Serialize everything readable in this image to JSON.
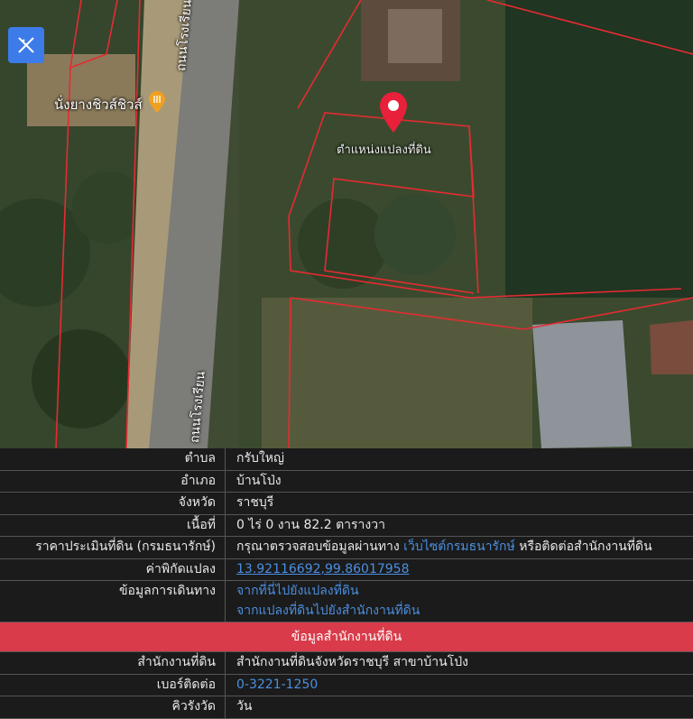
{
  "map": {
    "road_label_top": "ถนนโรงเรียน บ้านปูง",
    "road_label_bottom": "ถนนโรงเรียน",
    "poi_label": "นั่งยางชิวส์ชิวส์",
    "parcel_label": "ตำแหน่งแปลงที่ดิน",
    "tool_icon": "ruler-pencil-icon",
    "pin_color": "#e8203a"
  },
  "details": [
    {
      "label": "ตำบล",
      "value": "กรับใหญ่"
    },
    {
      "label": "อำเภอ",
      "value": "บ้านโป่ง"
    },
    {
      "label": "จังหวัด",
      "value": "ราชบุรี"
    },
    {
      "label": "เนื้อที่",
      "value": "0 ไร่ 0 งาน 82.2 ตารางวา"
    }
  ],
  "appraisal": {
    "label": "ราคาประเมินที่ดิน (กรมธนารักษ์)",
    "text_before": "กรุณาตรวจสอบข้อมูลผ่านทาง",
    "link": "เว็บไซต์กรมธนารักษ์",
    "text_after": "หรือติดต่อสำนักงานที่ดิน"
  },
  "coords": {
    "label": "ค่าพิกัดแปลง",
    "value": "13.92116692,99.86017958"
  },
  "directions": {
    "label": "ข้อมูลการเดินทาง",
    "link1": "จากที่นี่ไปยังแปลงที่ดิน",
    "link2": "จากแปลงที่ดินไปยังสำนักงานที่ดิน"
  },
  "office_banner": "ข้อมูลสำนักงานที่ดิน",
  "office": {
    "name_label": "สำนักงานที่ดิน",
    "name_value": "สำนักงานที่ดินจังหวัดราชบุรี สาขาบ้านโป่ง",
    "phone_label": "เบอร์ติดต่อ",
    "phone_value": "0-3221-1250",
    "queue_label": "คิวรังวัด",
    "queue_value": "วัน"
  },
  "colors": {
    "accent_red": "#d93b4a",
    "link_blue": "#4a8fe0",
    "tool_blue": "#3d7be8"
  }
}
